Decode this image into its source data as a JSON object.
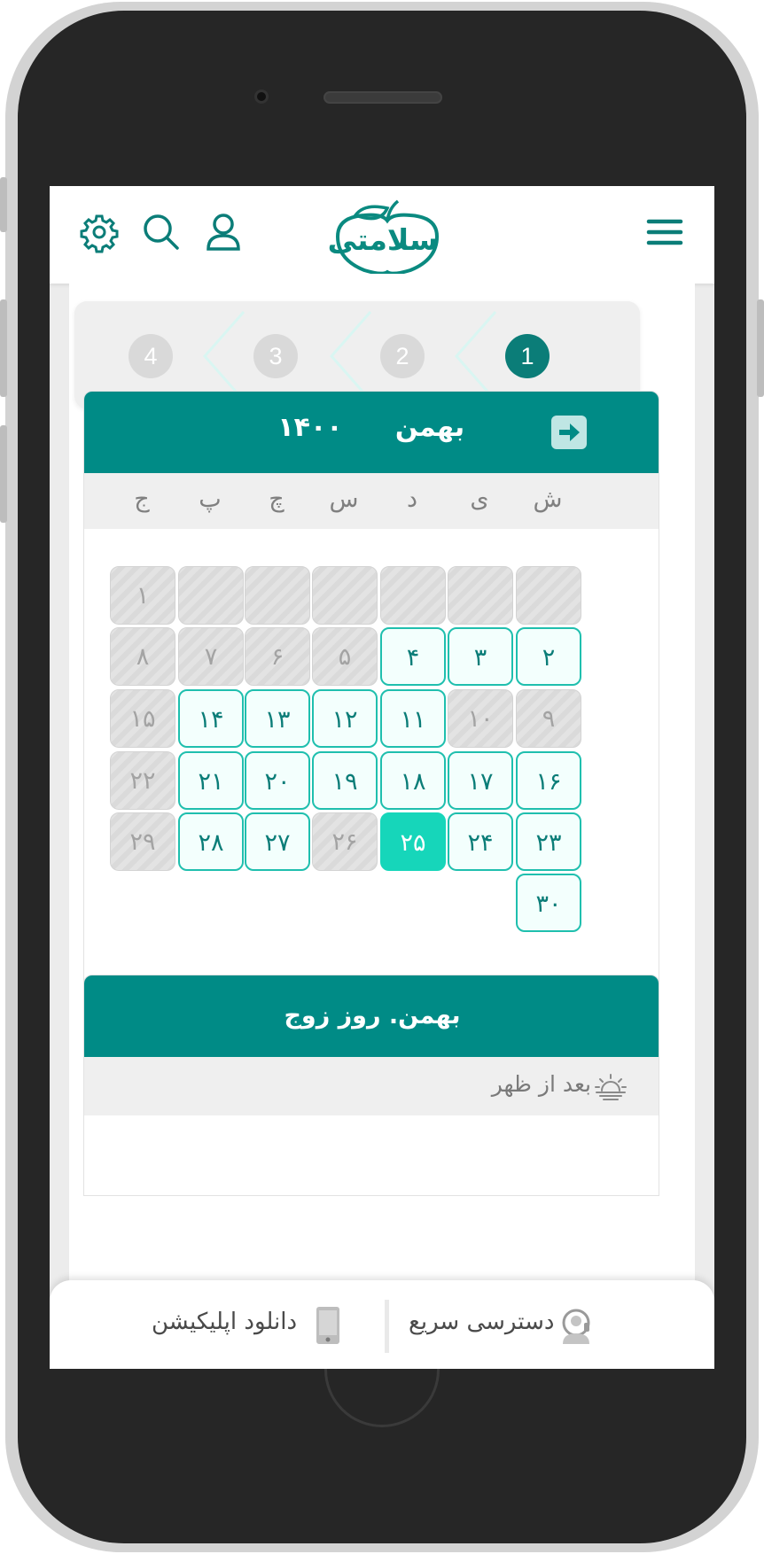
{
  "header": {
    "logo_text": "سلامتی",
    "menu_icon": "hamburger-menu-icon",
    "user_icon": "user-icon",
    "search_icon": "search-icon",
    "settings_icon": "gear-icon",
    "accent": "#0a8a80"
  },
  "stepper": {
    "steps": [
      "1",
      "2",
      "3",
      "4"
    ],
    "active_index": 0
  },
  "calendar": {
    "month": "بهمن",
    "year": "۱۴۰۰",
    "next_icon": "arrow-right-icon",
    "weekdays": [
      "ش",
      "ی",
      "د",
      "س",
      "چ",
      "پ",
      "ج"
    ],
    "days": [
      {
        "label": "",
        "state": "off"
      },
      {
        "label": "",
        "state": "off"
      },
      {
        "label": "",
        "state": "off"
      },
      {
        "label": "",
        "state": "off"
      },
      {
        "label": "",
        "state": "off"
      },
      {
        "label": "",
        "state": "off"
      },
      {
        "label": "۱",
        "state": "off"
      },
      {
        "label": "۲",
        "state": "avail"
      },
      {
        "label": "۳",
        "state": "avail"
      },
      {
        "label": "۴",
        "state": "avail"
      },
      {
        "label": "۵",
        "state": "off"
      },
      {
        "label": "۶",
        "state": "off"
      },
      {
        "label": "۷",
        "state": "off"
      },
      {
        "label": "۸",
        "state": "off"
      },
      {
        "label": "۹",
        "state": "off"
      },
      {
        "label": "۱۰",
        "state": "off"
      },
      {
        "label": "۱۱",
        "state": "avail"
      },
      {
        "label": "۱۲",
        "state": "avail"
      },
      {
        "label": "۱۳",
        "state": "avail"
      },
      {
        "label": "۱۴",
        "state": "avail"
      },
      {
        "label": "۱۵",
        "state": "off"
      },
      {
        "label": "۱۶",
        "state": "avail"
      },
      {
        "label": "۱۷",
        "state": "avail"
      },
      {
        "label": "۱۸",
        "state": "avail"
      },
      {
        "label": "۱۹",
        "state": "avail"
      },
      {
        "label": "۲۰",
        "state": "avail"
      },
      {
        "label": "۲۱",
        "state": "avail"
      },
      {
        "label": "۲۲",
        "state": "off"
      },
      {
        "label": "۲۳",
        "state": "avail"
      },
      {
        "label": "۲۴",
        "state": "avail"
      },
      {
        "label": "۲۵",
        "state": "sel"
      },
      {
        "label": "۲۶",
        "state": "off"
      },
      {
        "label": "۲۷",
        "state": "avail"
      },
      {
        "label": "۲۸",
        "state": "avail"
      },
      {
        "label": "۲۹",
        "state": "off"
      },
      {
        "label": "۳۰",
        "state": "avail"
      }
    ],
    "colors": {
      "header": "#008b86",
      "available_border": "#1fbfae",
      "selected": "#16d6ba",
      "disabled": "#dadada"
    }
  },
  "day_panel": {
    "title": "بهمن. روز زوج",
    "period_label": "بعد از ظهر",
    "period_icon": "sunset-icon"
  },
  "bottom_bar": {
    "quick_access_label": "دسترسی سریع",
    "quick_access_icon": "quick-access-icon",
    "download_label": "دانلود اپلیکیشن",
    "download_icon": "mobile-phone-icon"
  }
}
